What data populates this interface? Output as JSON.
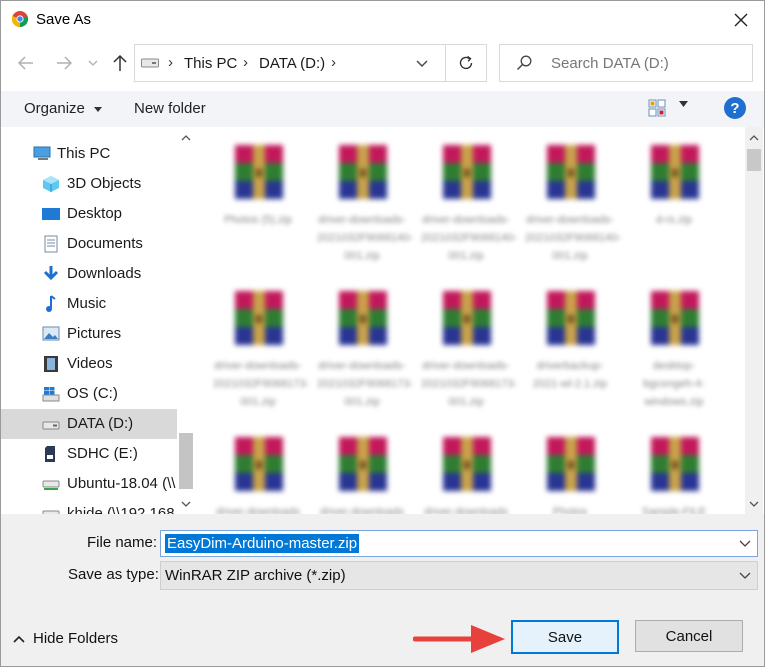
{
  "window": {
    "title": "Save As",
    "app_icon": "chrome-icon",
    "close_icon": "close-icon"
  },
  "address": {
    "crumbs": [
      "This PC",
      "DATA (D:)"
    ],
    "search_placeholder": "Search DATA (D:)"
  },
  "commands": {
    "organize": "Organize",
    "new_folder": "New folder",
    "help": "?"
  },
  "nav": {
    "items": [
      {
        "label": "This PC",
        "icon": "computer-icon",
        "root": true
      },
      {
        "label": "3D Objects",
        "icon": "3d-objects-icon"
      },
      {
        "label": "Desktop",
        "icon": "desktop-icon"
      },
      {
        "label": "Documents",
        "icon": "documents-icon"
      },
      {
        "label": "Downloads",
        "icon": "downloads-icon"
      },
      {
        "label": "Music",
        "icon": "music-icon"
      },
      {
        "label": "Pictures",
        "icon": "pictures-icon"
      },
      {
        "label": "Videos",
        "icon": "videos-icon"
      },
      {
        "label": "OS (C:)",
        "icon": "windows-drive-icon"
      },
      {
        "label": "DATA (D:)",
        "icon": "drive-icon",
        "selected": true
      },
      {
        "label": "SDHC (E:)",
        "icon": "sd-card-icon"
      },
      {
        "label": "Ubuntu-18.04 (\\\\",
        "icon": "network-drive-icon"
      },
      {
        "label": "khide (\\\\192.168",
        "icon": "network-drive-icon"
      }
    ]
  },
  "files": [
    {
      "name": "Photos (5).zip"
    },
    {
      "name": "driver-downloads-2021032F9068140-001.zip"
    },
    {
      "name": "driver-downloads-2021032F9068140-001.zip"
    },
    {
      "name": "driver-downloads-2021032F9068140-001.zip"
    },
    {
      "name": "d-rs.zip"
    },
    {
      "name": "driver-downloads-2021032F9068173-001.zip"
    },
    {
      "name": "driver-downloads-2021032F9068173-001.zip"
    },
    {
      "name": "driver-downloads-2021032F9068173-001.zip"
    },
    {
      "name": "driverbackup-2021-wl-2.1.zip"
    },
    {
      "name": "desktop-bgcongeh-4-windows.zip"
    },
    {
      "name": "driver-downloads"
    },
    {
      "name": "driver-downloads"
    },
    {
      "name": "driver-downloads"
    },
    {
      "name": "Photos"
    },
    {
      "name": "Sample-FILE"
    }
  ],
  "form": {
    "file_name_label": "File name:",
    "file_name_value": "EasyDim-Arduino-master.zip",
    "type_label": "Save as type:",
    "type_value": "WinRAR ZIP archive (*.zip)",
    "hide_folders": "Hide Folders",
    "save": "Save",
    "cancel": "Cancel"
  },
  "colors": {
    "accent": "#0078d7",
    "arrow": "#e8403a",
    "selection": "#d9d9d9"
  }
}
